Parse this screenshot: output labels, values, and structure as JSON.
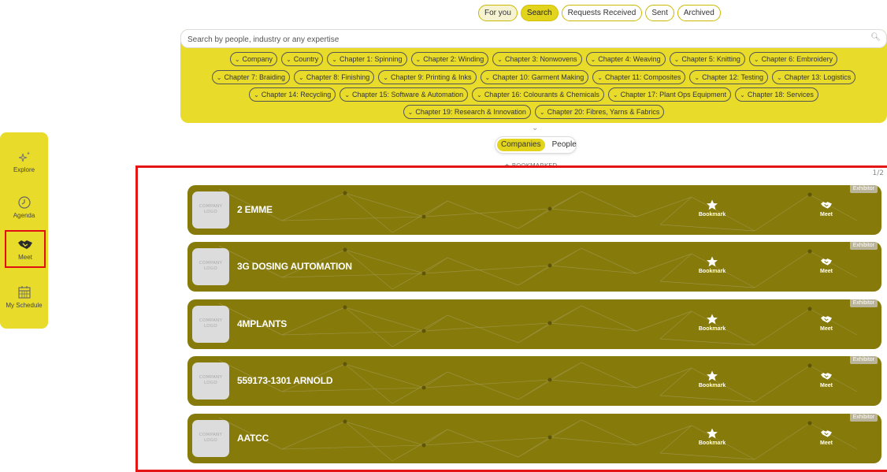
{
  "top_tabs": [
    {
      "label": "For you",
      "state": "soft"
    },
    {
      "label": "Search",
      "state": "active"
    },
    {
      "label": "Requests Received",
      "state": ""
    },
    {
      "label": "Sent",
      "state": ""
    },
    {
      "label": "Archived",
      "state": ""
    }
  ],
  "search": {
    "placeholder": "Search by people, industry or any expertise",
    "filter_rows": [
      [
        "Company",
        "Country",
        "Chapter 1: Spinning",
        "Chapter 2: Winding",
        "Chapter 3: Nonwovens",
        "Chapter 4: Weaving",
        "Chapter 5: Knitting",
        "Chapter 6: Embroidery"
      ],
      [
        "Chapter 7: Braiding",
        "Chapter 8: Finishing",
        "Chapter 9: Printing & Inks",
        "Chapter 10: Garment Making",
        "Chapter 11: Composites",
        "Chapter 12: Testing",
        "Chapter 13: Logistics"
      ],
      [
        "Chapter 14: Recycling",
        "Chapter 15: Software & Automation",
        "Chapter 16: Colourants & Chemicals",
        "Chapter 17: Plant Ops Equipment",
        "Chapter 18: Services"
      ],
      [
        "Chapter 19: Research & Innovation",
        "Chapter 20: Fibres, Yarns & Fabrics"
      ]
    ]
  },
  "entity_toggle": {
    "companies": "Companies",
    "people": "People"
  },
  "bookmarked_hint": "★ BOOKMARKED",
  "page_count": "1/2",
  "nav": {
    "explore": "Explore",
    "agenda": "Agenda",
    "meet": "Meet",
    "schedule": "My Schedule"
  },
  "logo_placeholder": "COMPANY LOGO",
  "bookmark_label": "Bookmark",
  "meet_label": "Meet",
  "companies": [
    {
      "name": "2 EMME",
      "badge": "Exhibitor"
    },
    {
      "name": "3G DOSING AUTOMATION",
      "badge": "Exhibitor"
    },
    {
      "name": "4MPLANTS",
      "badge": "Exhibitor"
    },
    {
      "name": "559173-1301 ARNOLD",
      "badge": "Exhibitor"
    },
    {
      "name": "AATCC",
      "badge": "Exhibitor"
    }
  ],
  "colors": {
    "accent": "#e8db2a",
    "card": "#857a0a",
    "highlight": "#e51515"
  }
}
